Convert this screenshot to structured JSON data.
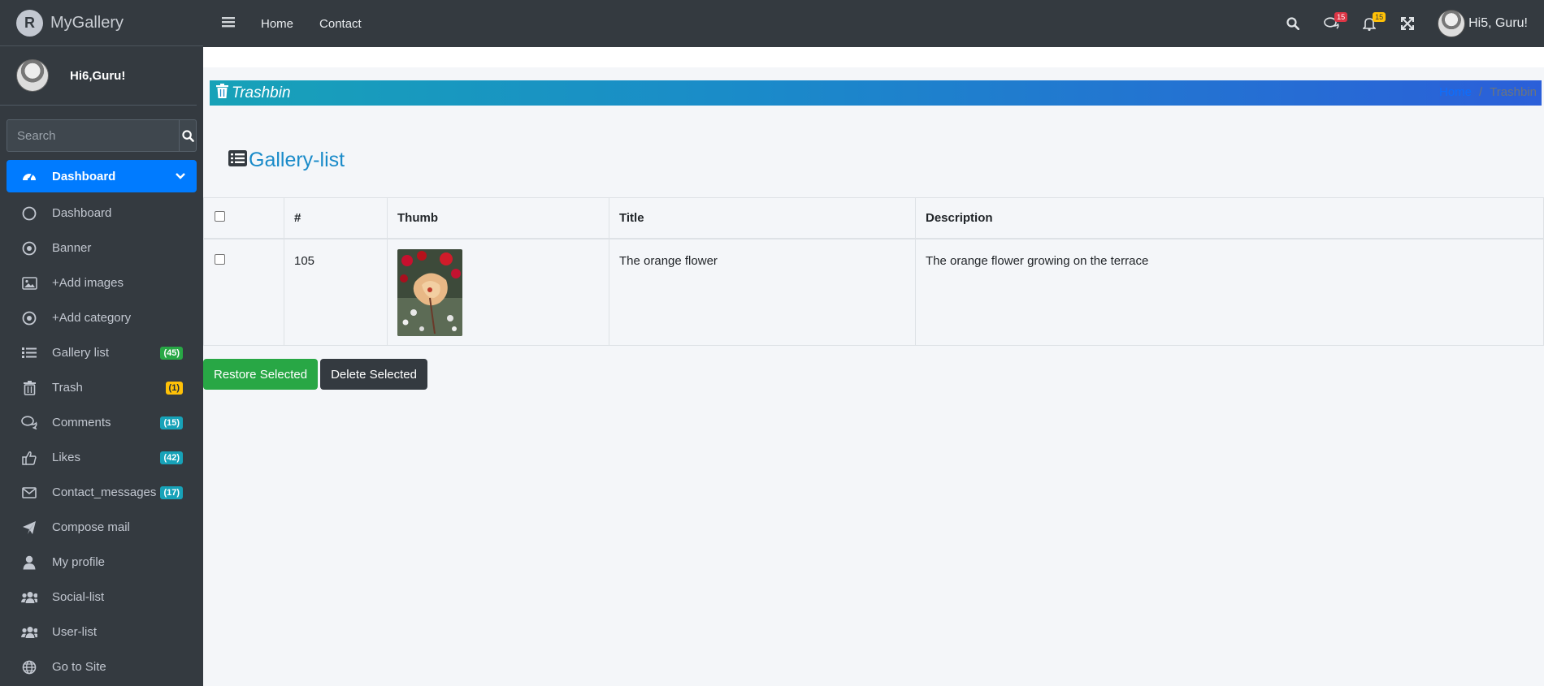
{
  "brand": {
    "name": "MyGallery",
    "logo": "R"
  },
  "sidebar": {
    "user": "Hi6,Guru!",
    "search_placeholder": "Search",
    "items": [
      {
        "label": "Dashboard",
        "icon": "tachometer-icon",
        "active": true
      },
      {
        "label": "Dashboard",
        "icon": "circle-icon"
      },
      {
        "label": "Banner",
        "icon": "dot-circle-icon"
      },
      {
        "label": "+Add images",
        "icon": "image-icon"
      },
      {
        "label": "+Add category",
        "icon": "dot-circle-icon"
      },
      {
        "label": "Gallery list",
        "icon": "list-icon",
        "badge": "(45)",
        "badge_color": "#28a745"
      },
      {
        "label": "Trash",
        "icon": "trash-icon",
        "badge": "(1)",
        "badge_color": "#ffc107"
      },
      {
        "label": "Comments",
        "icon": "comments-icon",
        "badge": "(15)",
        "badge_color": "#17a2b8"
      },
      {
        "label": "Likes",
        "icon": "thumbs-up-icon",
        "badge": "(42)",
        "badge_color": "#17a2b8"
      },
      {
        "label": "Contact_messages",
        "icon": "envelope-icon",
        "badge": "(17)",
        "badge_color": "#17a2b8"
      },
      {
        "label": "Compose mail",
        "icon": "paper-plane-icon"
      },
      {
        "label": "My profile",
        "icon": "user-icon"
      },
      {
        "label": "Social-list",
        "icon": "users-icon"
      },
      {
        "label": "User-list",
        "icon": "users-icon"
      },
      {
        "label": "Go to Site",
        "icon": "globe-icon"
      }
    ]
  },
  "topnav": {
    "links": [
      "Home",
      "Contact"
    ],
    "comments_count": "15",
    "notifications_count": "15",
    "user": "Hi5, Guru!"
  },
  "header": {
    "title": "Trashbin",
    "breadcrumb": [
      "Home",
      "/",
      "Trashbin"
    ]
  },
  "gallery": {
    "title": "Gallery-list",
    "columns": [
      "",
      "#",
      "Thumb",
      "Title",
      "Description"
    ],
    "rows": [
      {
        "id": "105",
        "title": "The orange flower",
        "description": "The orange flower growing on the terrace"
      }
    ]
  },
  "actions": {
    "restore": "Restore Selected",
    "delete": "Delete Selected"
  },
  "colors": {
    "primary": "#007bff",
    "sidebar": "#343a40",
    "success": "#28a745",
    "warning": "#ffc107",
    "info": "#17a2b8",
    "danger": "#dc3545"
  }
}
